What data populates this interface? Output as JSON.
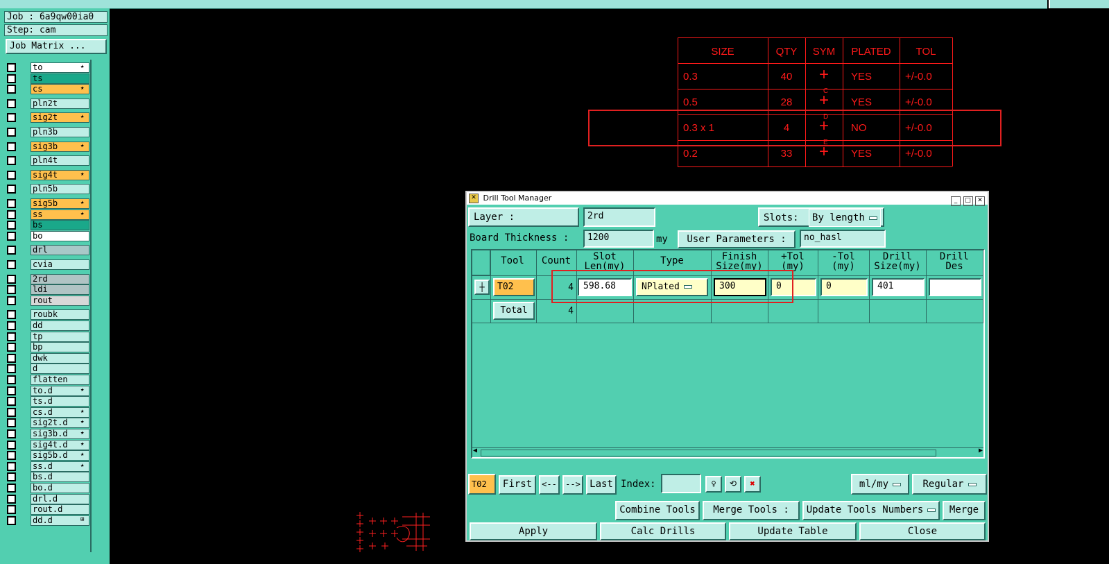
{
  "left_panel": {
    "job_label": "Job : 6a9qw00ia0",
    "step_label": "Step: cam",
    "job_matrix_button": "Job Matrix ...",
    "layers": [
      {
        "name": "to",
        "color": "#ffffff",
        "flag": "★"
      },
      {
        "name": "ts",
        "color": "#1aa88a",
        "flag": ""
      },
      {
        "name": "cs",
        "color": "#ffc04d",
        "flag": "★"
      },
      {
        "name": "pln2t",
        "color": "#bfeee6",
        "flag": ""
      },
      {
        "name": "sig2t",
        "color": "#ffc04d",
        "flag": "★"
      },
      {
        "name": "pln3b",
        "color": "#bfeee6",
        "flag": ""
      },
      {
        "name": "sig3b",
        "color": "#ffc04d",
        "flag": "★"
      },
      {
        "name": "pln4t",
        "color": "#bfeee6",
        "flag": ""
      },
      {
        "name": "sig4t",
        "color": "#ffc04d",
        "flag": "★"
      },
      {
        "name": "pln5b",
        "color": "#bfeee6",
        "flag": ""
      },
      {
        "name": "sig5b",
        "color": "#ffc04d",
        "flag": "★"
      },
      {
        "name": "ss",
        "color": "#ffc04d",
        "flag": "★"
      },
      {
        "name": "bs",
        "color": "#1aa88a",
        "flag": ""
      },
      {
        "name": "bo",
        "color": "#ffffff",
        "flag": ""
      },
      {
        "name": "drl",
        "color": "#a8c8c8",
        "flag": ""
      },
      {
        "name": "cvia",
        "color": "#bfeee6",
        "flag": ""
      },
      {
        "name": "2rd",
        "color": "#b0c4c4",
        "flag": ""
      },
      {
        "name": "ldi",
        "color": "#b0c4c4",
        "flag": ""
      },
      {
        "name": "rout",
        "color": "#d8d8d8",
        "flag": ""
      },
      {
        "name": "roubk",
        "color": "#bfeee6",
        "flag": ""
      },
      {
        "name": "dd",
        "color": "#bfeee6",
        "flag": ""
      },
      {
        "name": "tp",
        "color": "#bfeee6",
        "flag": ""
      },
      {
        "name": "bp",
        "color": "#bfeee6",
        "flag": ""
      },
      {
        "name": "dwk",
        "color": "#bfeee6",
        "flag": ""
      },
      {
        "name": "d",
        "color": "#bfeee6",
        "flag": ""
      },
      {
        "name": "flatten",
        "color": "#bfeee6",
        "flag": ""
      },
      {
        "name": "to.d",
        "color": "#bfeee6",
        "flag": "★"
      },
      {
        "name": "ts.d",
        "color": "#bfeee6",
        "flag": ""
      },
      {
        "name": "cs.d",
        "color": "#bfeee6",
        "flag": "★"
      },
      {
        "name": "sig2t.d",
        "color": "#bfeee6",
        "flag": "★"
      },
      {
        "name": "sig3b.d",
        "color": "#bfeee6",
        "flag": "★"
      },
      {
        "name": "sig4t.d",
        "color": "#bfeee6",
        "flag": "★"
      },
      {
        "name": "sig5b.d",
        "color": "#bfeee6",
        "flag": "★"
      },
      {
        "name": "ss.d",
        "color": "#bfeee6",
        "flag": "★"
      },
      {
        "name": "bs.d",
        "color": "#bfeee6",
        "flag": ""
      },
      {
        "name": "bo.d",
        "color": "#bfeee6",
        "flag": ""
      },
      {
        "name": "drl.d",
        "color": "#bfeee6",
        "flag": ""
      },
      {
        "name": "rout.d",
        "color": "#bfeee6",
        "flag": ""
      },
      {
        "name": "dd.d",
        "color": "#bfeee6",
        "flag": "⊞"
      }
    ]
  },
  "drill_table": {
    "headers": [
      "SIZE",
      "QTY",
      "SYM",
      "PLATED",
      "TOL"
    ],
    "rows": [
      {
        "size": "0.3",
        "qty": "40",
        "sym": "+",
        "plated": "YES",
        "tol": "+/-0.0"
      },
      {
        "size": "0.5",
        "qty": "28",
        "sym": "+",
        "plated": "YES",
        "tol": "+/-0.0"
      },
      {
        "size": "0.3 x 1",
        "qty": "4",
        "sym": "+",
        "plated": "NO",
        "tol": "+/-0.0"
      },
      {
        "size": "0.2",
        "qty": "33",
        "sym": "+",
        "plated": "YES",
        "tol": "+/-0.0"
      }
    ],
    "sym_marks": [
      "",
      "C",
      "D",
      "E"
    ]
  },
  "dialog": {
    "title": "Drill Tool Manager",
    "layer_label": "Layer          :",
    "layer_value": "2rd",
    "slots_label": "Slots:",
    "slots_value": "By length",
    "thickness_label": "Board Thickness :",
    "thickness_value": "1200",
    "thickness_unit": "my",
    "user_params_label": "User Parameters :",
    "user_params_value": "no_hasl",
    "columns": {
      "tool": "Tool",
      "count": "Count",
      "slot_len": "Slot\nLen(my)",
      "type": "Type",
      "finish": "Finish\nSize(my)",
      "ptol": "+Tol\n(my)",
      "ntol": "-Tol\n(my)",
      "drill_size": "Drill\nSize(my)",
      "drill_des": "Drill\nDes"
    },
    "row": {
      "tool": "T02",
      "count": "4",
      "slot_len": "598.68",
      "type": "NPlated",
      "finish": "300",
      "ptol": "0",
      "ntol": "0",
      "drill_size": "401",
      "drill_des": ""
    },
    "total_label": "Total",
    "total_count": "4",
    "nav": {
      "current": "T02",
      "first": "First",
      "prev": "<--",
      "next": "-->",
      "last": "Last",
      "index_label": "Index:",
      "units": "ml/my",
      "mode": "Regular"
    },
    "combine_tools": "Combine Tools",
    "merge_tools_label": "Merge Tools :",
    "merge_option": "Update Tools Numbers",
    "merge_button": "Merge",
    "apply": "Apply",
    "calc_drills": "Calc Drills",
    "update_table": "Update Table",
    "close": "Close"
  }
}
